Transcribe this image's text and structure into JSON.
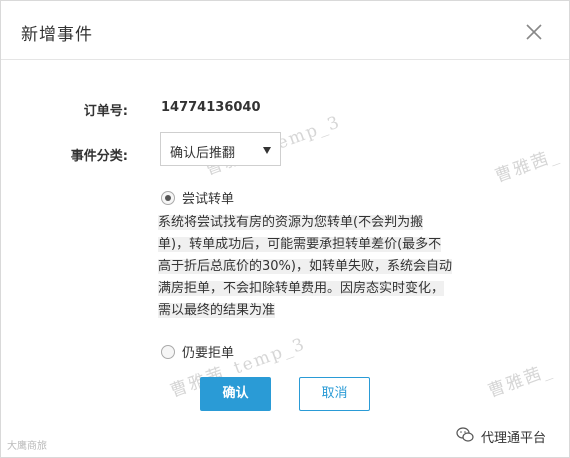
{
  "dialog": {
    "title": "新增事件",
    "close_icon": "close-icon"
  },
  "form": {
    "order_label": "订单号:",
    "order_value": "14774136040",
    "category_label": "事件分类:",
    "category_value": "确认后推翻"
  },
  "options": {
    "try_transfer_label": "尝试转单",
    "try_transfer_checked": true,
    "try_transfer_desc_lines": [
      "系统将尝试找有房的资源为您转单(不会判为搬",
      "单)，转单成功后，可能需要承担转单差价(最多不",
      "高于折后总底价的30%)，如转单失败，系统会自动",
      "满房拒单，不会扣除转单费用。因房态实时变化，",
      "需以最终的结果为准"
    ],
    "still_reject_label": "仍要拒单",
    "still_reject_checked": false
  },
  "buttons": {
    "confirm": "确认",
    "cancel": "取消"
  },
  "watermarks": {
    "text": "曹雅茜_temp_3",
    "right_text": "曹雅茜_"
  },
  "footer": {
    "left": "大鹰商旅",
    "right": "代理通平台"
  },
  "colors": {
    "accent": "#2a9bd6",
    "desc_bg": "#f0f0f0"
  }
}
